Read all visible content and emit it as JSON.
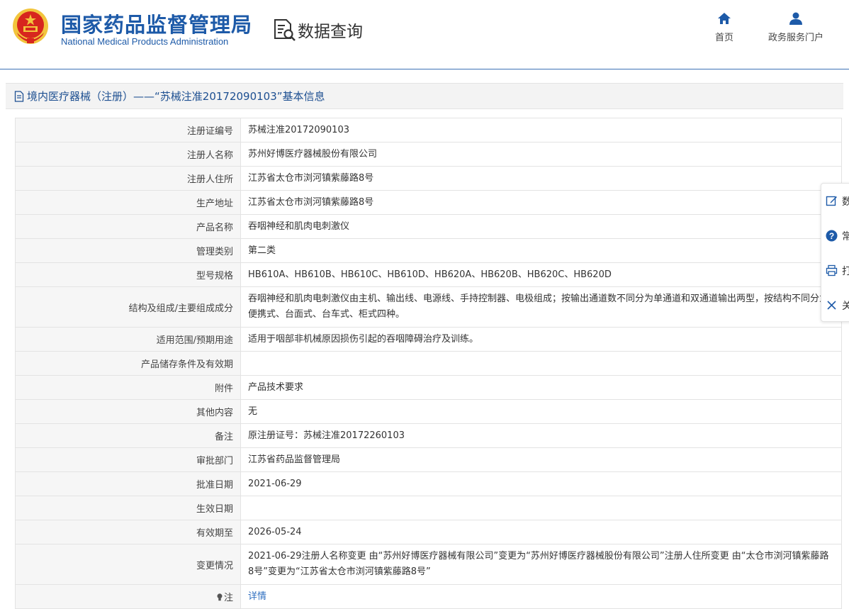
{
  "header": {
    "org_name_cn": "国家药品监督管理局",
    "org_name_en": "National Medical Products Administration",
    "query_title": "数据查询",
    "nav": [
      {
        "label": "首页",
        "icon": "home-icon"
      },
      {
        "label": "政务服务门户",
        "icon": "user-icon"
      }
    ]
  },
  "title_bar": {
    "text": "境内医疗器械（注册）——“苏械注准20172090103”基本信息"
  },
  "details": [
    {
      "label": "注册证编号",
      "value": "苏械注准20172090103"
    },
    {
      "label": "注册人名称",
      "value": "苏州好博医疗器械股份有限公司"
    },
    {
      "label": "注册人住所",
      "value": "江苏省太仓市浏河镇紫藤路8号"
    },
    {
      "label": "生产地址",
      "value": "江苏省太仓市浏河镇紫藤路8号"
    },
    {
      "label": "产品名称",
      "value": "吞咽神经和肌肉电刺激仪"
    },
    {
      "label": "管理类别",
      "value": "第二类"
    },
    {
      "label": "型号规格",
      "value": "HB610A、HB610B、HB610C、HB610D、HB620A、HB620B、HB620C、HB620D"
    },
    {
      "label": "结构及组成/主要组成成分",
      "value": "吞咽神经和肌肉电刺激仪由主机、输出线、电源线、手持控制器、电极组成；按输出通道数不同分为单通道和双通道输出两型，按结构不同分为便携式、台面式、台车式、柜式四种。"
    },
    {
      "label": "适用范围/预期用途",
      "value": "适用于咽部非机械原因损伤引起的吞咽障碍治疗及训练。"
    },
    {
      "label": "产品储存条件及有效期",
      "value": ""
    },
    {
      "label": "附件",
      "value": "产品技术要求"
    },
    {
      "label": "其他内容",
      "value": "无"
    },
    {
      "label": "备注",
      "value": "原注册证号：苏械注准20172260103"
    },
    {
      "label": "审批部门",
      "value": "江苏省药品监督管理局"
    },
    {
      "label": "批准日期",
      "value": "2021-06-29"
    },
    {
      "label": "生效日期",
      "value": ""
    },
    {
      "label": "有效期至",
      "value": "2026-05-24"
    },
    {
      "label": "变更情况",
      "value": "2021-06-29注册人名称变更 由“苏州好博医疗器械有限公司”变更为“苏州好博医疗器械股份有限公司”注册人住所变更 由“太仓市浏河镇紫藤路8号”变更为“江苏省太仓市浏河镇紫藤路8号”"
    },
    {
      "label": "注",
      "value": "详情"
    }
  ],
  "float_panel": [
    {
      "label": "数",
      "icon": "edit-icon"
    },
    {
      "label": "常",
      "icon": "help-icon"
    },
    {
      "label": "打",
      "icon": "print-icon"
    },
    {
      "label": "关",
      "icon": "close-icon"
    }
  ],
  "colors": {
    "brand_blue": "#1d5aa8",
    "link_blue": "#2f6fc0",
    "emblem_red": "#d7261e",
    "emblem_gold": "#f2c53d"
  }
}
